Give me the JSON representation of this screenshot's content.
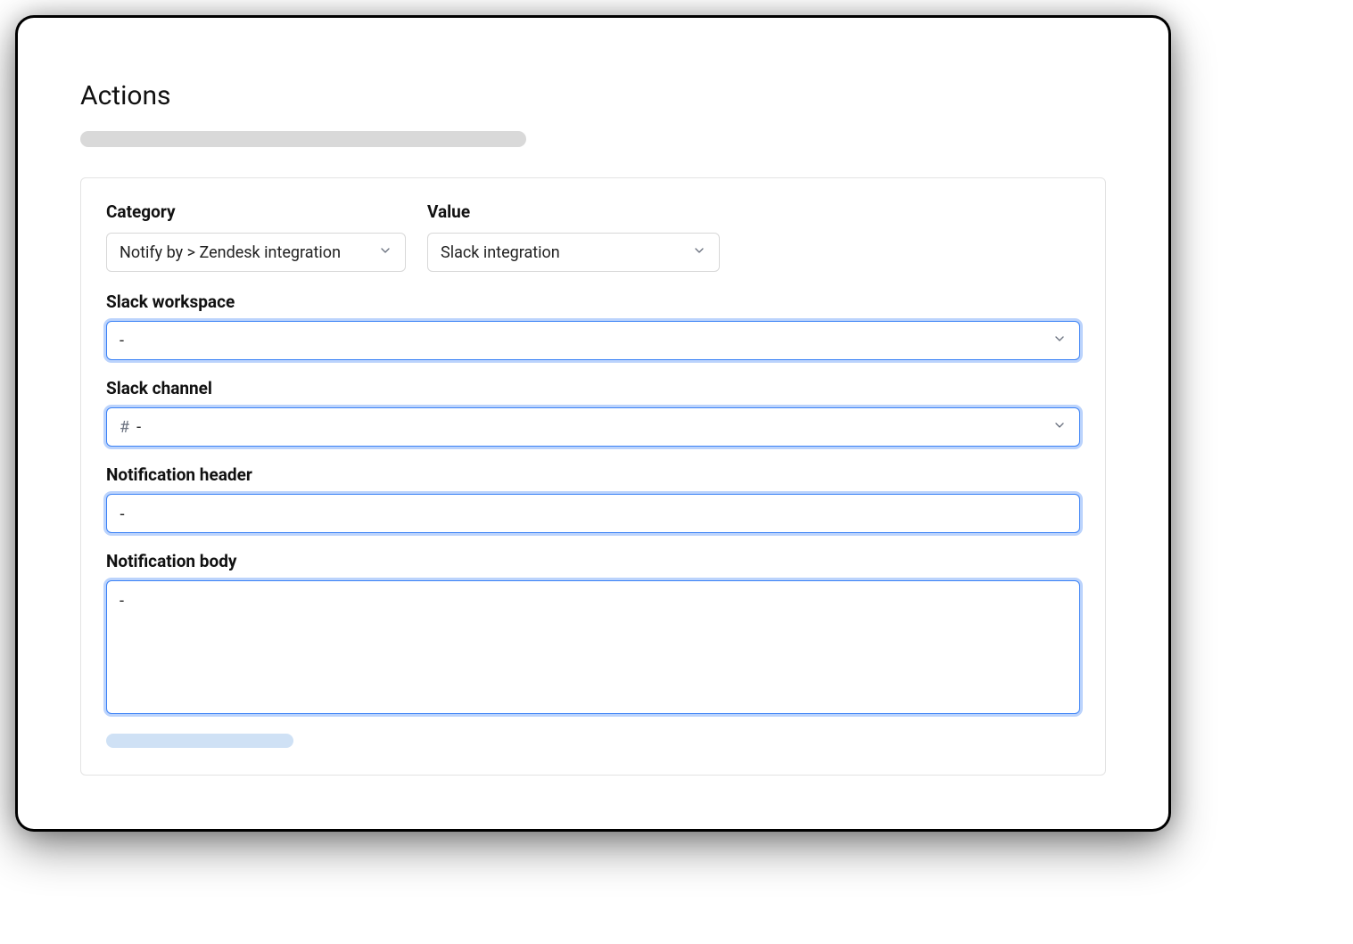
{
  "header": {
    "title": "Actions"
  },
  "form": {
    "category": {
      "label": "Category",
      "value": "Notify by > Zendesk integration"
    },
    "value_field": {
      "label": "Value",
      "value": "Slack integration"
    },
    "slack_workspace": {
      "label": "Slack workspace",
      "value": "-"
    },
    "slack_channel": {
      "label": "Slack channel",
      "prefix": "#",
      "value": "-"
    },
    "notification_header": {
      "label": "Notification header",
      "value": "-"
    },
    "notification_body": {
      "label": "Notification body",
      "value": "-"
    }
  }
}
